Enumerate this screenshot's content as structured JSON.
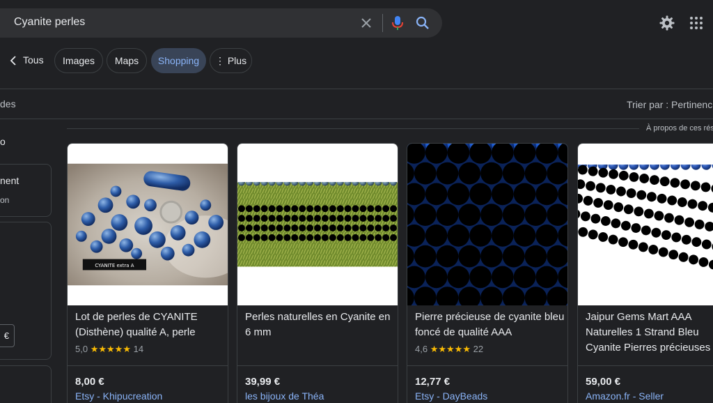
{
  "search": {
    "query": "Cyanite perles"
  },
  "tabs": [
    {
      "label": "Tous"
    },
    {
      "label": "Images"
    },
    {
      "label": "Maps"
    },
    {
      "label": "Shopping"
    },
    {
      "label": "Plus"
    }
  ],
  "filters_bar": {
    "left_text": "des",
    "sort_text": "Trier par : Pertinenc"
  },
  "about_text": "À propos de ces résu",
  "sidebar": {
    "item_1": "o",
    "box_1_title": "nent",
    "box_1_sub": "on",
    "currency": "€"
  },
  "products": [
    {
      "image_caption": "CYANITE extra A",
      "title": "Lot de perles de CYANITE (Disthène) qualité A, perle",
      "rating_value": "5,0",
      "stars": "★★★★★",
      "reviews": "14",
      "price": "8,00 €",
      "seller": "Etsy - Khipucreation"
    },
    {
      "title": "Perles naturelles en Cyanite en 6 mm",
      "rating_value": "",
      "stars": "",
      "reviews": "",
      "price": "39,99 €",
      "seller": "les bijoux de Théa"
    },
    {
      "title": "Pierre précieuse de cyanite bleu foncé de qualité AAA",
      "rating_value": "4,6",
      "stars": "★★★★★",
      "reviews": "22",
      "price": "12,77 €",
      "seller": "Etsy - DayBeads"
    },
    {
      "title": "Jaipur Gems Mart AAA Naturelles 1 Strand Bleu Cyanite Pierres précieuses",
      "rating_value": "",
      "stars": "",
      "reviews": "",
      "price": "59,00 €",
      "seller": "Amazon.fr - Seller"
    }
  ],
  "colors": {
    "background": "#202124",
    "surface": "#303134",
    "link": "#8ab4f8",
    "active_tab_bg": "#394457",
    "stars": "#fbbc04"
  }
}
